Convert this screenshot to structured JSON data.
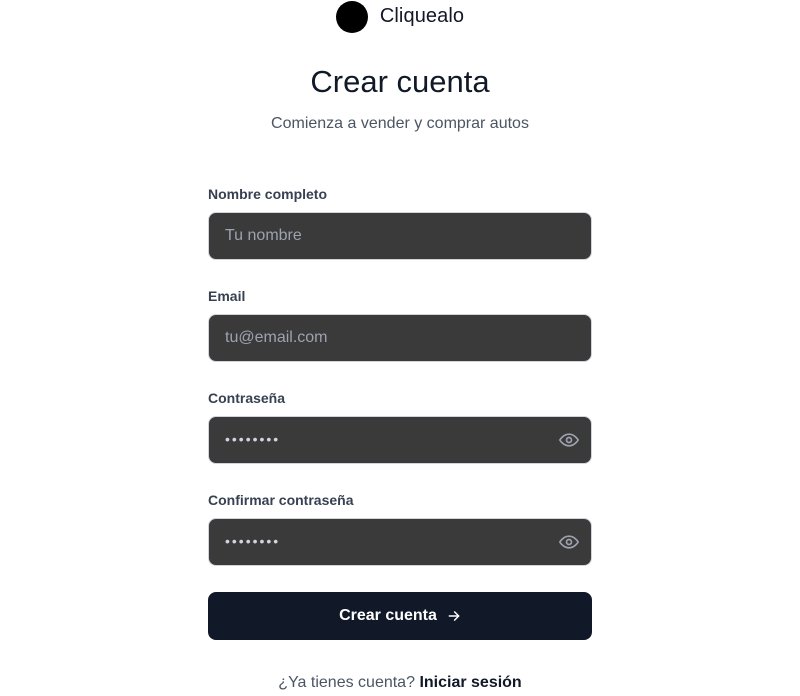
{
  "brand": {
    "name": "Cliquealo",
    "logo_icon": "circle-logo-icon"
  },
  "header": {
    "title": "Crear cuenta",
    "subtitle": "Comienza a vender y comprar autos"
  },
  "form": {
    "fields": [
      {
        "label": "Nombre completo",
        "placeholder": "Tu nombre",
        "value": ""
      },
      {
        "label": "Email",
        "placeholder": "tu@email.com",
        "value": ""
      },
      {
        "label": "Contraseña",
        "placeholder": "••••••••",
        "value": "",
        "toggle_icon": "eye-icon"
      },
      {
        "label": "Confirmar contraseña",
        "placeholder": "••••••••",
        "value": "",
        "toggle_icon": "eye-icon"
      }
    ],
    "submit_label": "Crear cuenta",
    "submit_icon": "arrow-right-icon"
  },
  "footer": {
    "prompt": "¿Ya tienes cuenta?",
    "link_label": "Iniciar sesión"
  },
  "colors": {
    "input_bg": "#3a3a3a",
    "primary_button": "#111827",
    "text_primary": "#111827",
    "text_secondary": "#4b5563"
  }
}
